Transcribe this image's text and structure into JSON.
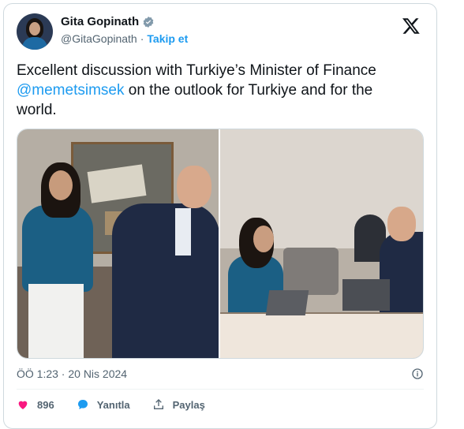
{
  "author": {
    "name": "Gita Gopinath",
    "handle": "@GitaGopinath",
    "separator": "·",
    "follow_label": "Takip et",
    "verified_icon": "verified-badge-icon",
    "brand_color": "#1d9bf0"
  },
  "tweet": {
    "text_before": "Excellent discussion with Turkiye’s Minister of Finance ",
    "mention": "@memetsimsek",
    "text_after": " on the outlook for Turkiye and for the world."
  },
  "meta": {
    "timestamp": "ÖÖ 1:23 · 20 Nis 2024"
  },
  "actions": {
    "like_count": "896",
    "reply_label": "Yanıtla",
    "share_label": "Paylaş",
    "like_color": "#f91880",
    "reply_color": "#1d9bf0"
  }
}
